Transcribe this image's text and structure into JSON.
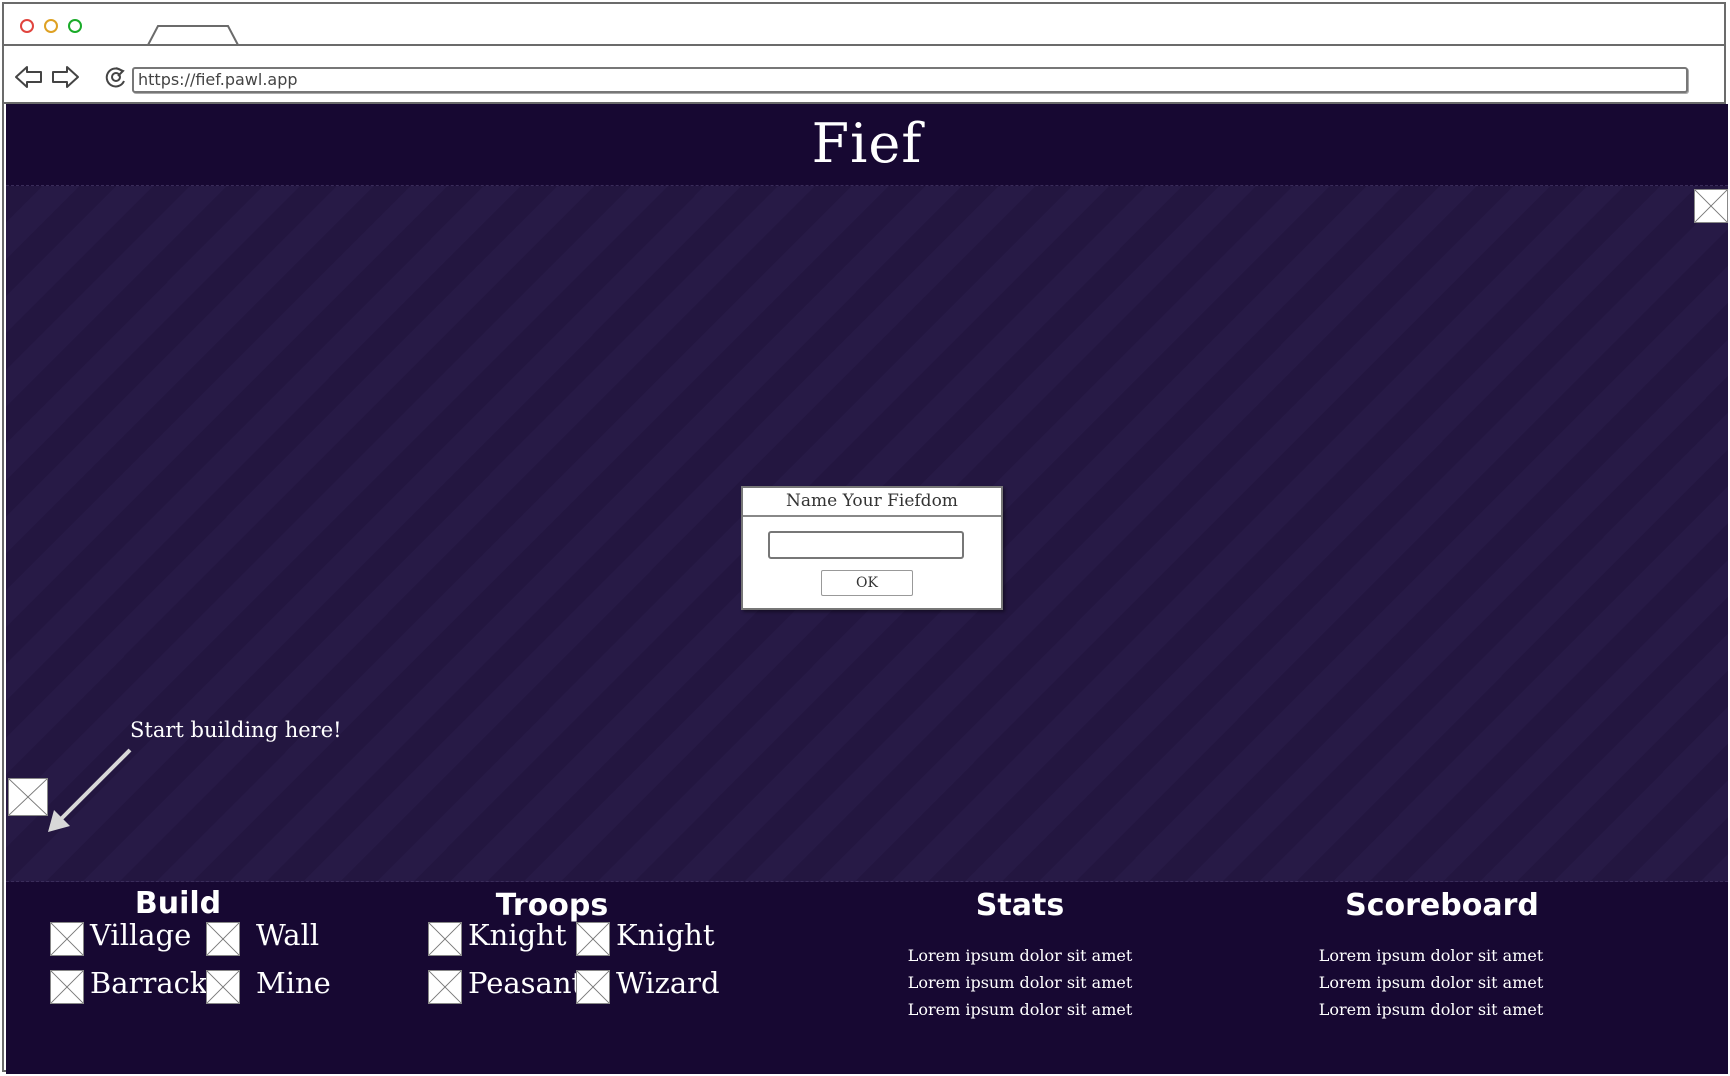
{
  "browser": {
    "url": "https://fief.pawl.app"
  },
  "app": {
    "title": "Fief"
  },
  "dialog": {
    "title": "Name Your Fiefdom",
    "input_value": "",
    "ok_label": "OK"
  },
  "hint": {
    "text": "Start building here!"
  },
  "build": {
    "title": "Build",
    "items": [
      {
        "label": "Village"
      },
      {
        "label": "Wall"
      },
      {
        "label": "Barrack"
      },
      {
        "label": "Mine"
      }
    ]
  },
  "troops": {
    "title": "Troops",
    "items": [
      {
        "label": "Knight"
      },
      {
        "label": "Knight"
      },
      {
        "label": "Peasant"
      },
      {
        "label": "Wizard"
      }
    ]
  },
  "stats": {
    "title": "Stats",
    "lines": [
      "Lorem ipsum dolor sit amet",
      "Lorem ipsum dolor sit amet",
      "Lorem ipsum dolor sit amet"
    ]
  },
  "scoreboard": {
    "title": "Scoreboard",
    "lines": [
      "Lorem ipsum dolor sit amet",
      "Lorem ipsum dolor sit amet",
      "Lorem ipsum dolor sit amet"
    ]
  },
  "colors": {
    "app_background": "#170832",
    "board_background": "#231640",
    "text": "#ffffff"
  },
  "icons": {
    "back": "arrow-left-icon",
    "forward": "arrow-right-icon",
    "reload": "reload-icon",
    "image_placeholder": "image-placeholder-icon"
  }
}
